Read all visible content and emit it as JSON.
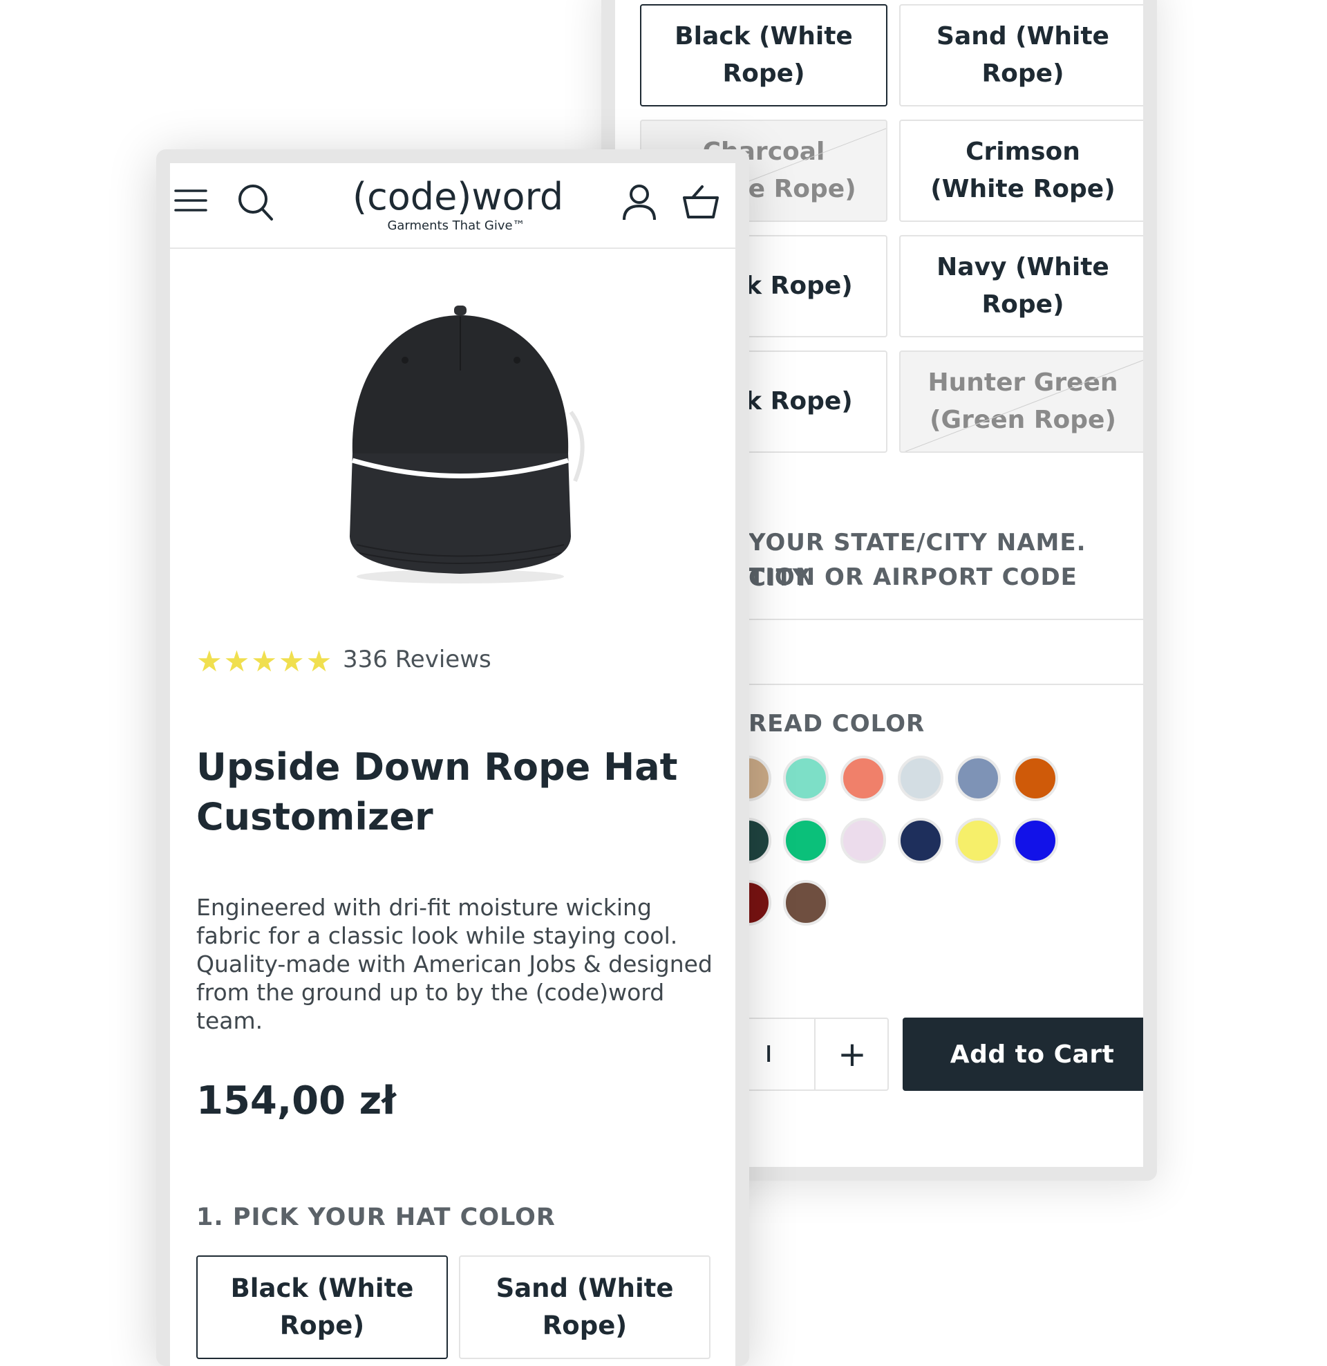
{
  "brand": {
    "logo": "(code)word",
    "tagline": "Garments That Give™"
  },
  "product": {
    "rating_stars": 5,
    "reviews": "336 Reviews",
    "title": "Upside Down Rope Hat Customizer",
    "description": "Engineered with dri-fit moisture wicking fabric for a classic look while staying cool. Quality-made with American Jobs & designed from the ground up to by the (code)word team.",
    "price": "154,00 zł"
  },
  "hat_color": {
    "label": "1. PICK YOUR HAT COLOR",
    "options": [
      {
        "label": "Black (White Rope)",
        "state": "selected"
      },
      {
        "label": "Sand (White Rope)",
        "state": "available"
      },
      {
        "label": "Charcoal (White Rope)",
        "state": "sold-out"
      },
      {
        "label": "Crimson (White Rope)",
        "state": "available"
      },
      {
        "label": "(Black Rope)",
        "state": "available"
      },
      {
        "label": "Navy (White Rope)",
        "state": "available"
      },
      {
        "label": "(Black Rope)",
        "state": "available"
      },
      {
        "label": "Hunter Green (Green Rope)",
        "state": "sold-out"
      }
    ]
  },
  "city": {
    "label_line1": "YOUR STATE/CITY NAME. CITY",
    "label_line2": "TION OR AIRPORT CODE",
    "value": ""
  },
  "thread": {
    "label": "READ COLOR",
    "colors": [
      "#c9a986",
      "#7ddfc7",
      "#f0806a",
      "#d3dde3",
      "#7e93b6",
      "#cf5a09",
      "#1f4440",
      "#0bc07a",
      "#ecdcec",
      "#1e2f5c",
      "#f6ef6a",
      "#1212e8",
      "#7a1312",
      "#6f4f40"
    ]
  },
  "cart": {
    "qty_partial": "ı",
    "plus": "+",
    "add_to_cart": "Add to Cart"
  }
}
